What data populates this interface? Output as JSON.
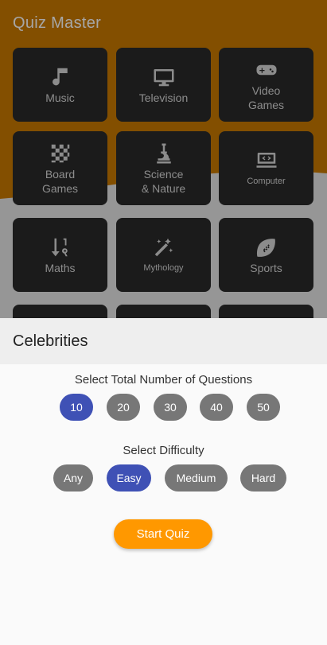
{
  "app": {
    "title": "Quiz Master"
  },
  "categories": [
    {
      "label": "Music",
      "icon": "music-note-icon"
    },
    {
      "label": "Television",
      "icon": "tv-icon"
    },
    {
      "label": "Video\nGames",
      "icon": "gamepad-icon"
    },
    {
      "label": "Board\nGames",
      "icon": "chessboard-icon"
    },
    {
      "label": "Science\n& Nature",
      "icon": "microscope-icon"
    },
    {
      "label": "Computer",
      "icon": "laptop-code-icon"
    },
    {
      "label": "Maths",
      "icon": "sort-numeric-icon"
    },
    {
      "label": "Mythology",
      "icon": "magic-wand-icon"
    },
    {
      "label": "Sports",
      "icon": "football-icon"
    }
  ],
  "sheet": {
    "title": "Celebrities",
    "questions_label": "Select Total Number of Questions",
    "question_counts": [
      "10",
      "20",
      "30",
      "40",
      "50"
    ],
    "selected_count": "10",
    "difficulty_label": "Select Difficulty",
    "difficulties": [
      "Any",
      "Easy",
      "Medium",
      "Hard"
    ],
    "selected_difficulty": "Easy",
    "start_label": "Start Quiz"
  },
  "colors": {
    "header_orange": "#C97A00",
    "chip_selected": "#3F51B5",
    "chip_default": "#777777",
    "start_button": "#FF9800"
  }
}
